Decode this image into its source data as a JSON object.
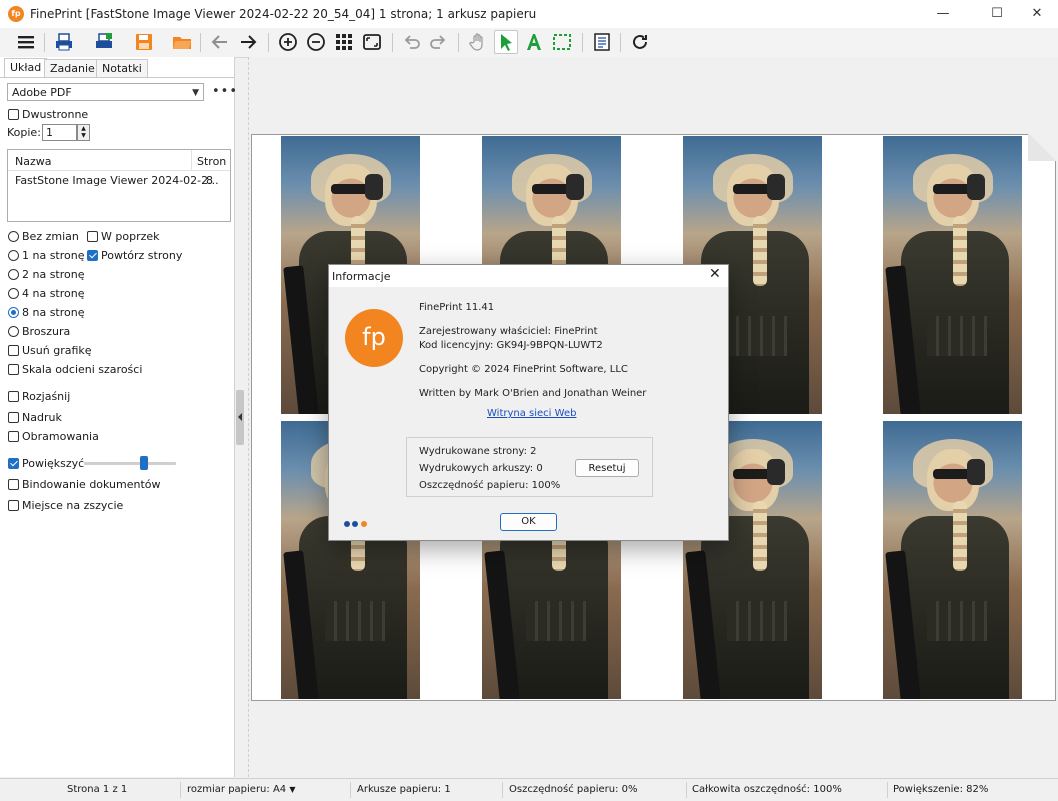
{
  "window": {
    "title": "FinePrint [FastStone Image Viewer 2024-02-22 20_54_04] 1 strona; 1 arkusz papieru",
    "app_icon_text": "fp",
    "minimize": "—",
    "maximize": "☐",
    "close": "✕"
  },
  "toolbar": {
    "icons": [
      "menu-icon",
      "print-icon",
      "print-setup-icon",
      "save-icon",
      "open-folder-icon",
      "arrow-left-icon",
      "arrow-right-icon",
      "zoom-in-icon",
      "zoom-out-icon",
      "grid-icon",
      "fit-page-icon",
      "undo-icon",
      "redo-icon",
      "hand-icon",
      "pointer-icon",
      "text-icon",
      "select-rect-icon",
      "properties-icon",
      "refresh-icon"
    ],
    "active": "pointer-icon",
    "accent_orange": "#f2851f",
    "accent_green": "#1e9e3a"
  },
  "left": {
    "tabs": [
      "Układ",
      "Zadanie",
      "Notatki"
    ],
    "printer": "Adobe PDF",
    "more": "•••",
    "duplex_label": "Dwustronne",
    "copies_label": "Kopie:",
    "copies_value": "1",
    "jobs": {
      "col_name": "Nazwa",
      "col_pages": "Stron",
      "rows": [
        {
          "name": "FastStone Image Viewer 2024-02-2...",
          "pages": "8"
        }
      ]
    },
    "layout_options": [
      {
        "label": "Bez zmian",
        "checked": false
      },
      {
        "label": "1 na stronę",
        "checked": false
      },
      {
        "label": "2 na stronę",
        "checked": false
      },
      {
        "label": "4 na stronę",
        "checked": false
      },
      {
        "label": "8 na stronę",
        "checked": true
      },
      {
        "label": "Broszura",
        "checked": false
      }
    ],
    "w_poprzek": "W poprzek",
    "powtorz": "Powtórz strony",
    "usun_grafike": "Usuń grafikę",
    "skala_szarosci": "Skala odcieni szarości",
    "rozjasnij": "Rozjaśnij",
    "nadruk": "Nadruk",
    "obramowania": "Obramowania",
    "powieksz": "Powiększyć",
    "zoom_fraction": 0.65,
    "bindowanie": "Bindowanie dokumentów",
    "miejsce": "Miejsce na zszycie"
  },
  "dialog": {
    "title": "Informacje",
    "close": "✕",
    "logo": "fp",
    "version": "FinePrint 11.41",
    "owner": "Zarejestrowany właściciel:  FinePrint",
    "license": "Kod licencyjny:  GK94J-9BPQN-LUWT2",
    "copyright": "Copyright © 2024 FinePrint Software, LLC",
    "authors": "Written by Mark O'Brien and Jonathan Weiner",
    "website": "Witryna sieci Web",
    "printed_pages": "Wydrukowane strony:  2",
    "printed_sheets": "Wydrukowych arkuszy:  0",
    "paper_savings": "Oszczędność papieru:  100%",
    "reset": "Resetuj",
    "ok": "OK",
    "dot_colors": [
      "#1f4f9c",
      "#1f4f9c",
      "#f2851f"
    ]
  },
  "status": {
    "page": "Strona 1 z 1",
    "paper_size": "rozmiar papieru: A4",
    "sheets": "Arkusze papieru: 1",
    "saving": "Oszczędność papieru: 0%",
    "total_saving": "Całkowita oszczędność: 100%",
    "zoom": "Powiększenie: 82%"
  }
}
